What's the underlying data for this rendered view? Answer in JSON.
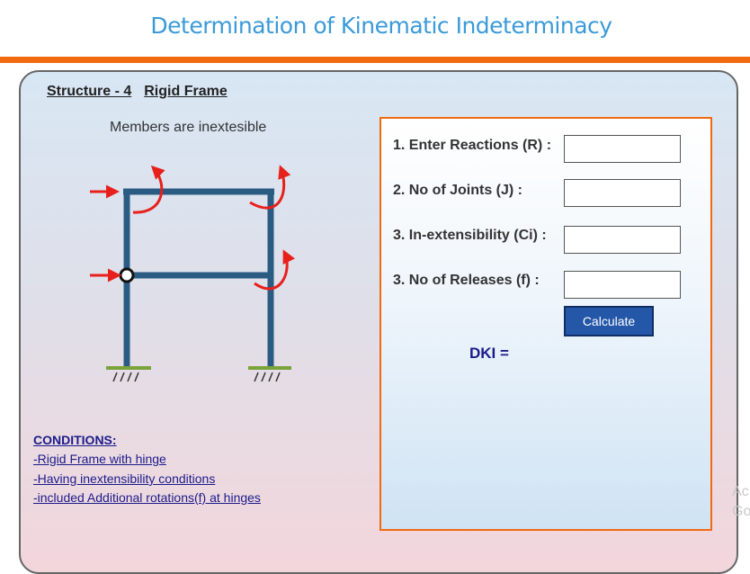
{
  "header": {
    "title": "Determination of Kinematic Indeterminacy"
  },
  "structure": {
    "number_label": "Structure - 4",
    "type_label": "Rigid Frame",
    "note": "Members are inextesible"
  },
  "conditions": {
    "title": "CONDITIONS:",
    "items": [
      "-Rigid Frame with hinge",
      "-Having inextensibility conditions",
      "-included Additional rotations(f) at hinges"
    ]
  },
  "form": {
    "fields": [
      {
        "label": "1. Enter Reactions (R) :",
        "value": ""
      },
      {
        "label": "2. No of Joints (J) :",
        "value": ""
      },
      {
        "label": "3. In-extensibility (Ci) :",
        "value": ""
      },
      {
        "label": "3. No of Releases (f) :",
        "value": ""
      }
    ],
    "calculate_label": "Calculate",
    "result_label": "DKI ="
  },
  "watermark": {
    "line1": "Ac",
    "line2": "Go"
  },
  "colors": {
    "accent_orange": "#f26a10",
    "title_blue": "#3a9ad9",
    "frame_blue": "#2a5b83",
    "arrow_red": "#e8201c",
    "support_green": "#7aa33a",
    "button_blue": "#2457a8",
    "dark_text": "#1b1b8a"
  }
}
